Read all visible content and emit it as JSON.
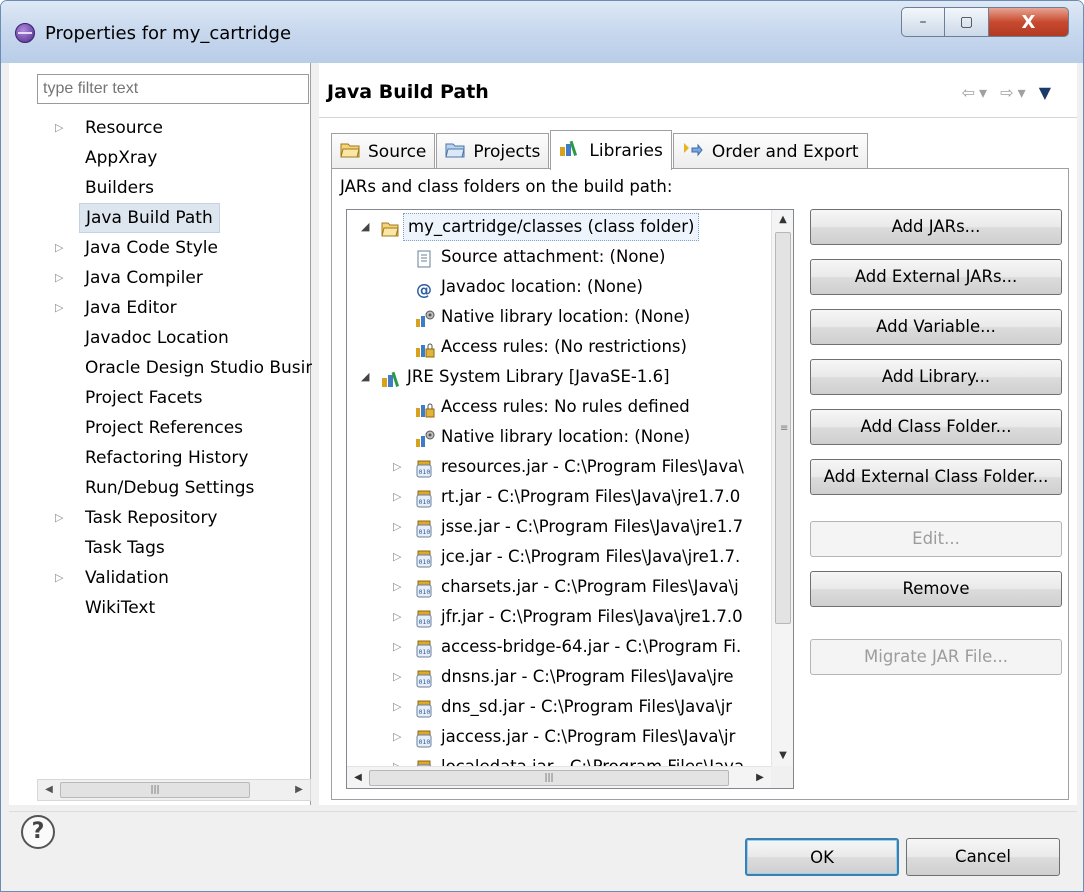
{
  "window": {
    "title": "Properties for my_cartridge",
    "minimize": "–",
    "maximize": "▢",
    "close": "X"
  },
  "filter": {
    "placeholder": "type filter text"
  },
  "nav": {
    "items": [
      {
        "label": "Resource",
        "expandable": true
      },
      {
        "label": "AppXray",
        "expandable": false
      },
      {
        "label": "Builders",
        "expandable": false
      },
      {
        "label": "Java Build Path",
        "expandable": false,
        "selected": true
      },
      {
        "label": "Java Code Style",
        "expandable": true
      },
      {
        "label": "Java Compiler",
        "expandable": true
      },
      {
        "label": "Java Editor",
        "expandable": true
      },
      {
        "label": "Javadoc Location",
        "expandable": false
      },
      {
        "label": "Oracle Design Studio Busin",
        "expandable": false
      },
      {
        "label": "Project Facets",
        "expandable": false
      },
      {
        "label": "Project References",
        "expandable": false
      },
      {
        "label": "Refactoring History",
        "expandable": false
      },
      {
        "label": "Run/Debug Settings",
        "expandable": false
      },
      {
        "label": "Task Repository",
        "expandable": true
      },
      {
        "label": "Task Tags",
        "expandable": false
      },
      {
        "label": "Validation",
        "expandable": true
      },
      {
        "label": "WikiText",
        "expandable": false
      }
    ]
  },
  "page": {
    "title": "Java Build Path",
    "description": "JARs and class folders on the build path:"
  },
  "tabs": [
    {
      "label": "Source",
      "icon": "source-folder-icon"
    },
    {
      "label": "Projects",
      "icon": "projects-folder-icon"
    },
    {
      "label": "Libraries",
      "icon": "libraries-icon",
      "active": true
    },
    {
      "label": "Order and Export",
      "icon": "order-export-icon"
    }
  ],
  "tree": {
    "rows": [
      {
        "label": "my_cartridge/classes (class folder)",
        "level": 0,
        "twisty": "expanded",
        "icon": "class-folder-icon",
        "selected": true
      },
      {
        "label": "Source attachment: (None)",
        "level": 1,
        "icon": "source-attachment-icon"
      },
      {
        "label": "Javadoc location: (None)",
        "level": 1,
        "icon": "javadoc-icon"
      },
      {
        "label": "Native library location: (None)",
        "level": 1,
        "icon": "native-library-icon"
      },
      {
        "label": "Access rules: (No restrictions)",
        "level": 1,
        "icon": "access-rules-icon"
      },
      {
        "label": "JRE System Library [JavaSE-1.6]",
        "level": 0,
        "twisty": "expanded",
        "icon": "library-icon"
      },
      {
        "label": "Access rules: No rules defined",
        "level": 1,
        "icon": "access-rules-icon"
      },
      {
        "label": "Native library location: (None)",
        "level": 1,
        "icon": "native-library-icon"
      },
      {
        "label": "resources.jar - C:\\Program Files\\Java\\",
        "level": 1,
        "twisty": "collapsed",
        "icon": "jar-icon"
      },
      {
        "label": "rt.jar - C:\\Program Files\\Java\\jre1.7.0",
        "level": 1,
        "twisty": "collapsed",
        "icon": "jar-icon"
      },
      {
        "label": "jsse.jar - C:\\Program Files\\Java\\jre1.7",
        "level": 1,
        "twisty": "collapsed",
        "icon": "jar-icon"
      },
      {
        "label": "jce.jar - C:\\Program Files\\Java\\jre1.7.",
        "level": 1,
        "twisty": "collapsed",
        "icon": "jar-icon"
      },
      {
        "label": "charsets.jar - C:\\Program Files\\Java\\j",
        "level": 1,
        "twisty": "collapsed",
        "icon": "jar-icon"
      },
      {
        "label": "jfr.jar - C:\\Program Files\\Java\\jre1.7.0",
        "level": 1,
        "twisty": "collapsed",
        "icon": "jar-icon"
      },
      {
        "label": "access-bridge-64.jar - C:\\Program Fi.",
        "level": 1,
        "twisty": "collapsed",
        "icon": "jar-icon"
      },
      {
        "label": "dnsns.jar - C:\\Program Files\\Java\\jre",
        "level": 1,
        "twisty": "collapsed",
        "icon": "jar-icon"
      },
      {
        "label": "dns_sd.jar - C:\\Program Files\\Java\\jr",
        "level": 1,
        "twisty": "collapsed",
        "icon": "jar-icon"
      },
      {
        "label": "jaccess.jar - C:\\Program Files\\Java\\jr",
        "level": 1,
        "twisty": "collapsed",
        "icon": "jar-icon"
      },
      {
        "label": "localedata.jar - C:\\Program Files\\Java",
        "level": 1,
        "twisty": "collapsed",
        "icon": "jar-icon"
      }
    ]
  },
  "buttons": {
    "add_jars": "Add JARs...",
    "add_external_jars": "Add External JARs...",
    "add_variable": "Add Variable...",
    "add_library": "Add Library...",
    "add_class_folder": "Add Class Folder...",
    "add_external_class_folder": "Add External Class Folder...",
    "edit": "Edit...",
    "remove": "Remove",
    "migrate_jar": "Migrate JAR File..."
  },
  "dialog": {
    "ok": "OK",
    "cancel": "Cancel",
    "help": "?"
  },
  "colors": {
    "selection": "#dde5ef",
    "ok_border": "#3c7fb1",
    "titlebar": "#c9d9ee",
    "close_button": "#c74a2f"
  }
}
